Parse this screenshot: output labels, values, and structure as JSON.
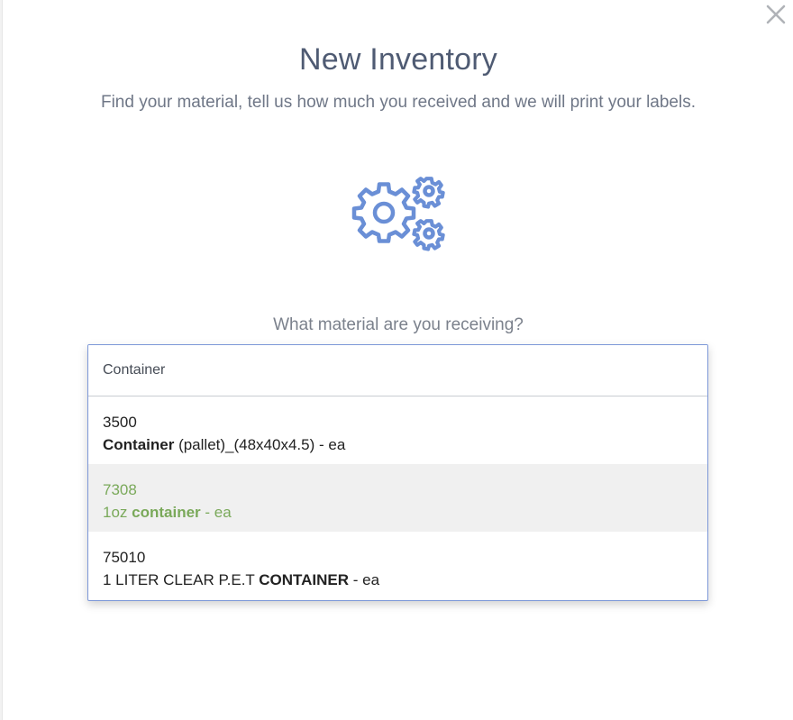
{
  "modal": {
    "title": "New Inventory",
    "subtitle": "Find your material, tell us how much you received and we will print your labels.",
    "icon": "gears-icon",
    "question": "What material are you receiving?",
    "close_icon": "close-icon"
  },
  "search": {
    "value": "Container"
  },
  "results": [
    {
      "code": "3500",
      "pre": "",
      "match": "Container",
      "post": " (pallet)_(48x40x4.5) - ea",
      "active": false
    },
    {
      "code": "7308",
      "pre": "1oz ",
      "match": "container",
      "post": " - ea",
      "active": true
    },
    {
      "code": "75010",
      "pre": "1 LITER CLEAR P.E.T ",
      "match": "CONTAINER",
      "post": " - ea",
      "active": false
    }
  ],
  "colors": {
    "title": "#4f5b73",
    "icon": "#6a8fd6",
    "focus_border": "#7d98d8",
    "highlight_text": "#7aa95a",
    "highlight_bg": "#f0f0f0"
  }
}
